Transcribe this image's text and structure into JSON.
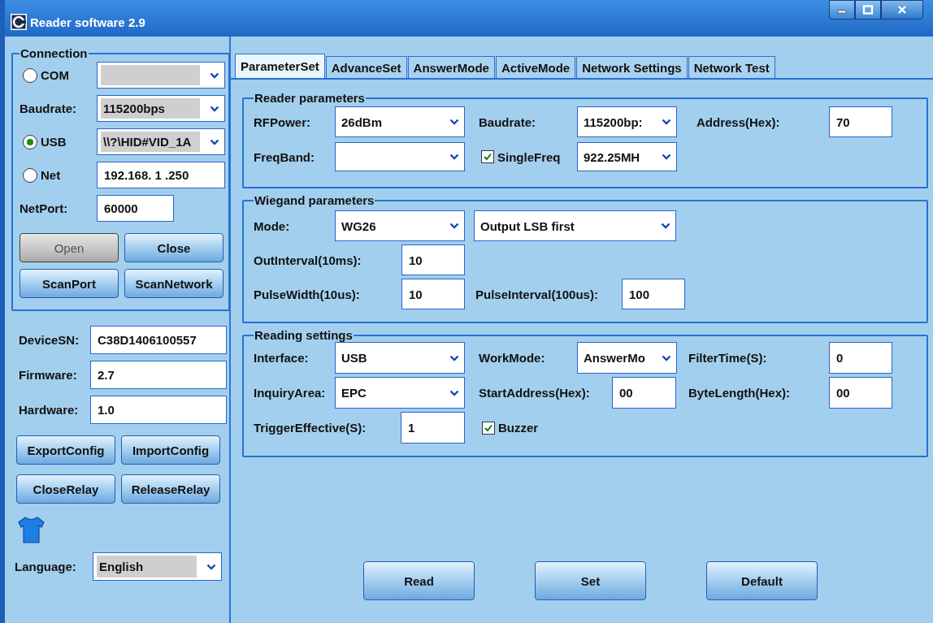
{
  "window": {
    "title": "Reader software 2.9"
  },
  "connection": {
    "title": "Connection",
    "com": {
      "label": "COM",
      "selected": false
    },
    "baudrate": {
      "label": "Baudrate:",
      "value": "115200bps"
    },
    "usb": {
      "label": "USB",
      "selected": true,
      "value": "\\\\?\\HID#VID_1A"
    },
    "net": {
      "label": "Net",
      "selected": false,
      "value": "192.168. 1 .250"
    },
    "netport": {
      "label": "NetPort:",
      "value": "60000"
    },
    "buttons": [
      {
        "label": "Open",
        "disabled": true
      },
      {
        "label": "Close",
        "disabled": false
      },
      {
        "label": "ScanPort",
        "disabled": false
      },
      {
        "label": "ScanNetwork",
        "disabled": false
      }
    ]
  },
  "device": [
    {
      "label": "DeviceSN:",
      "value": "C38D1406100557"
    },
    {
      "label": "Firmware:",
      "value": "2.7"
    },
    {
      "label": "Hardware:",
      "value": "1.0"
    }
  ],
  "device_buttons": [
    "ExportConfig",
    "ImportConfig",
    "CloseRelay",
    "ReleaseRelay"
  ],
  "language": {
    "label": "Language:",
    "value": "English"
  },
  "tabs": [
    {
      "label": "ParameterSet",
      "selected": true
    },
    {
      "label": "AdvanceSet",
      "selected": false
    },
    {
      "label": "AnswerMode",
      "selected": false
    },
    {
      "label": "ActiveMode",
      "selected": false
    },
    {
      "label": "Network Settings",
      "selected": false
    },
    {
      "label": "Network Test",
      "selected": false
    }
  ],
  "reader_parameters": {
    "title": "Reader parameters",
    "rf_power": {
      "label": "RFPower:",
      "value": "26dBm"
    },
    "baudrate": {
      "label": "Baudrate:",
      "value": "115200bp:"
    },
    "address": {
      "label": "Address(Hex):",
      "value": "70"
    },
    "freq_band": {
      "label": "FreqBand:"
    },
    "single_freq": {
      "label": "SingleFreq",
      "checked": true,
      "value": "922.25MH"
    }
  },
  "wiegand_parameters": {
    "title": "Wiegand parameters",
    "mode": {
      "label": "Mode:",
      "value": "WG26"
    },
    "bit_order": {
      "value": "Output LSB first"
    },
    "out_interval": {
      "label": "OutInterval(10ms):",
      "value": "10"
    },
    "pulse_width": {
      "label": "PulseWidth(10us):",
      "value": "10"
    },
    "pulse_interval": {
      "label": "PulseInterval(100us):",
      "value": "100"
    }
  },
  "reading_settings": {
    "title": "Reading settings",
    "interface": {
      "label": "Interface:",
      "value": "USB"
    },
    "work_mode": {
      "label": "WorkMode:",
      "value": "AnswerMo"
    },
    "filter_time": {
      "label": "FilterTime(S):",
      "value": "0"
    },
    "inquiry_area": {
      "label": "InquiryArea:",
      "value": "EPC"
    },
    "start_address": {
      "label": "StartAddress(Hex):",
      "value": "00"
    },
    "byte_length": {
      "label": "ByteLength(Hex):",
      "value": "00"
    },
    "trigger_effective": {
      "label": "TriggerEffective(S):",
      "value": "1"
    },
    "buzzer": {
      "label": "Buzzer",
      "checked": true
    }
  },
  "actions": [
    "Read",
    "Set",
    "Default"
  ]
}
